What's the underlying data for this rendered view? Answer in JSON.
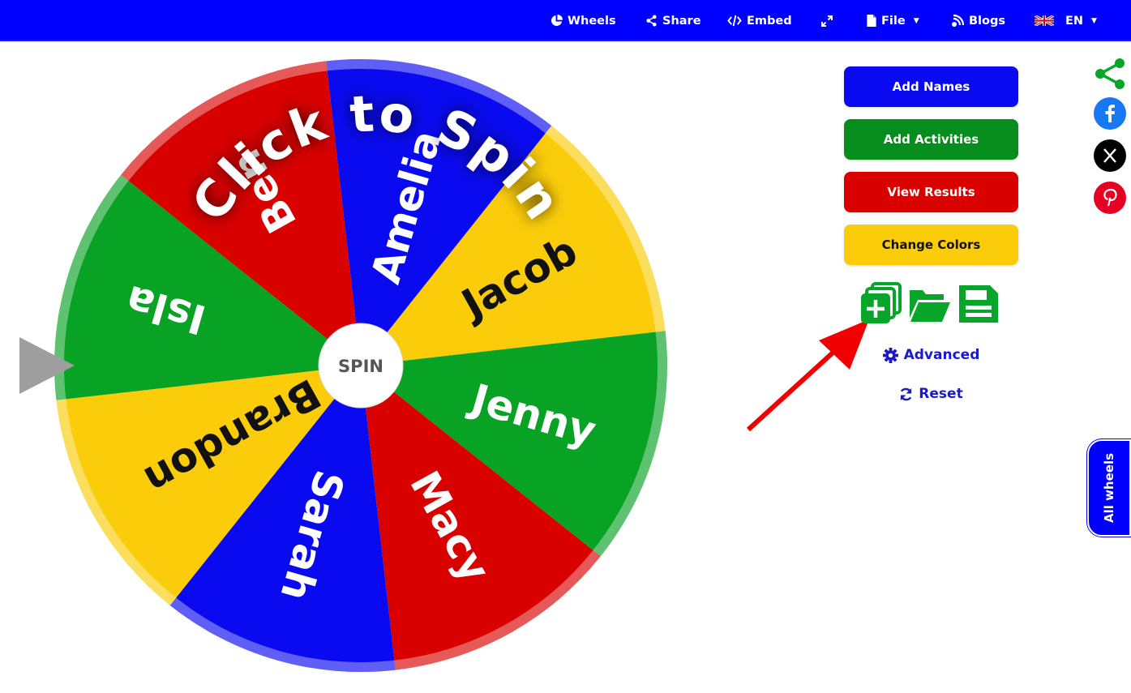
{
  "nav": {
    "wheels": "Wheels",
    "share": "Share",
    "embed": "Embed",
    "file": "File",
    "blogs": "Blogs",
    "language": "EN"
  },
  "wheel": {
    "segments": [
      {
        "name": "Amelia",
        "color": "#0a0af0"
      },
      {
        "name": "Jacob",
        "color": "#fbcc0a"
      },
      {
        "name": "Jenny",
        "color": "#08a224"
      },
      {
        "name": "Macy",
        "color": "#d90000"
      },
      {
        "name": "Sarah",
        "color": "#0a0af0"
      },
      {
        "name": "Brandon",
        "color": "#fbcc0a"
      },
      {
        "name": "Isla",
        "color": "#08a224"
      },
      {
        "name": "Ben",
        "color": "#d90000"
      }
    ],
    "spin_label": "SPIN",
    "overlay_text": "Click to Spin"
  },
  "panel": {
    "add_names": "Add Names",
    "add_activities": "Add Activities",
    "view_results": "View Results",
    "change_colors": "Change Colors",
    "advanced": "Advanced",
    "reset": "Reset"
  },
  "colors": {
    "nav_blue": "#0000ff",
    "add_names_bg": "#0a0af0",
    "add_activities_bg": "#078c1e",
    "view_results_bg": "#d90000",
    "change_colors_bg": "#fbcc0a",
    "icon_green": "#07a62a",
    "annotation_arrow": "#f00000"
  },
  "side": {
    "all_wheels": "All wheels"
  }
}
